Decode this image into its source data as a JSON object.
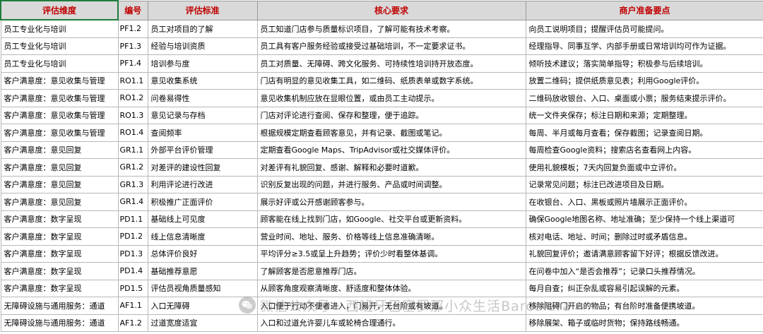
{
  "headers": [
    "评估维度",
    "编号",
    "评估标准",
    "核心要求",
    "商户准备要点"
  ],
  "rows": [
    {
      "dimension": "员工专业化与培训",
      "code": "PF1.2",
      "standard": "员工对项目的了解",
      "requirement": "员工知道门店参与质量标识项目，了解可能有技术考察。",
      "preparation": "向员工说明项目；提醒评估员可能提问。"
    },
    {
      "dimension": "员工专业化与培训",
      "code": "PF1.3",
      "standard": "经验与培训资质",
      "requirement": "员工具有客户服务经验或接受过基础培训，不一定要求证书。",
      "preparation": "经理指导、同事互学、内部手册或日常培训均可作为证据。"
    },
    {
      "dimension": "员工专业化与培训",
      "code": "PF1.4",
      "standard": "培训参与度",
      "requirement": "员工对质量、无障碍、跨文化服务、可持续性培训持开放态度。",
      "preparation": "倾听技术建议；落实简单指导；积极参与后续培训。"
    },
    {
      "dimension": "客户满意度：意见收集与管理",
      "code": "RO1.1",
      "standard": "意见收集系统",
      "requirement": "门店有明显的意见收集工具，如二维码、纸质表单或数字系统。",
      "preparation": "放置二维码；提供纸质意见表；利用Google评价。"
    },
    {
      "dimension": "客户满意度：意见收集与管理",
      "code": "RO1.2",
      "standard": "问卷易得性",
      "requirement": "意见收集机制应放在显眼位置，或由员工主动提示。",
      "preparation": "二维码放收银台、入口、桌面或小票；服务结束提示评价。"
    },
    {
      "dimension": "客户满意度：意见收集与管理",
      "code": "RO1.3",
      "standard": "意见记录与存档",
      "requirement": "门店对评论进行查阅、保存和整理，便于追踪。",
      "preparation": "统一文件夹保存；标注日期和来源；定期整理。"
    },
    {
      "dimension": "客户满意度：意见收集与管理",
      "code": "RO1.4",
      "standard": "查阅频率",
      "requirement": "根据规模定期查看顾客意见，并有记录、截图或笔记。",
      "preparation": "每周、半月或每月查看；保存截图；记录查阅日期。"
    },
    {
      "dimension": "客户满意度：意见回复",
      "code": "GR1.1",
      "standard": "外部平台评价管理",
      "requirement": "定期查看Google Maps、TripAdvisor或社交媒体评价。",
      "preparation": "每周检查Google资料；搜索店名查看网上内容。"
    },
    {
      "dimension": "客户满意度：意见回复",
      "code": "GR1.2",
      "standard": "对差评的建设性回复",
      "requirement": "对差评有礼貌回复、感谢、解释和必要时道歉。",
      "preparation": "使用礼貌模板；7天内回复负面或中立评价。"
    },
    {
      "dimension": "客户满意度：意见回复",
      "code": "GR1.3",
      "standard": "利用评论进行改进",
      "requirement": "识别反复出现的问题，并进行服务、产品或时间调整。",
      "preparation": "记录常见问题；标注已改进项目及日期。"
    },
    {
      "dimension": "客户满意度：意见回复",
      "code": "GR1.4",
      "standard": "积极推广正面评价",
      "requirement": "展示好评或公开感谢顾客参与。",
      "preparation": "在收银台、入口、黑板或照片墙展示正面评价。"
    },
    {
      "dimension": "客户满意度：数字呈现",
      "code": "PD1.1",
      "standard": "基础线上可见度",
      "requirement": "顾客能在线上找到门店，如Google、社交平台或更新资料。",
      "preparation": "确保Google地图名称、地址准确；至少保持一个线上渠道可"
    },
    {
      "dimension": "客户满意度：数字呈现",
      "code": "PD1.2",
      "standard": "线上信息清晰度",
      "requirement": "营业时间、地址、服务、价格等线上信息准确清晰。",
      "preparation": "核对电话、地址、时间；删除过时或矛盾信息。"
    },
    {
      "dimension": "客户满意度：数字呈现",
      "code": "PD1.3",
      "standard": "总体评价良好",
      "requirement": "平均评分≥3.5或呈上升趋势；评价少时看整体基调。",
      "preparation": "礼貌回复评价；邀请满意顾客留下好评；根据反馈改进。"
    },
    {
      "dimension": "客户满意度：数字呈现",
      "code": "PD1.4",
      "standard": "基础推荐意愿",
      "requirement": "了解顾客是否愿意推荐门店。",
      "preparation": "在问卷中加入“是否会推荐”；记录口头推荐情况。"
    },
    {
      "dimension": "客户满意度：数字呈现",
      "code": "PD1.5",
      "standard": "评估员视角质量感知",
      "requirement": "从顾客角度观察清晰度、舒适度和整体体验。",
      "preparation": "每月自查；纠正杂乱或容易引起误解的元素。"
    },
    {
      "dimension": "无障碍设施与通用服务：通道",
      "code": "AF1.1",
      "standard": "入口无障碍",
      "requirement": "入口便于行动不便者进入，门易开，无台阶或有坡道。",
      "preparation": "移除阻碍门开启的物品；有台阶时准备便携坡道。"
    },
    {
      "dimension": "无障碍设施与通用服务：通道",
      "code": "AF1.2",
      "standard": "过道宽度适宜",
      "requirement": "入口和过道允许婴儿车或轮椅合理通行。",
      "preparation": "移除展架、箱子或临时货物；保持路线畅通。"
    }
  ],
  "watermark": {
    "text": "微信公众号 · 西班牙巴塞罗那小众生活Barcelera",
    "icon": "wechat-icon"
  }
}
